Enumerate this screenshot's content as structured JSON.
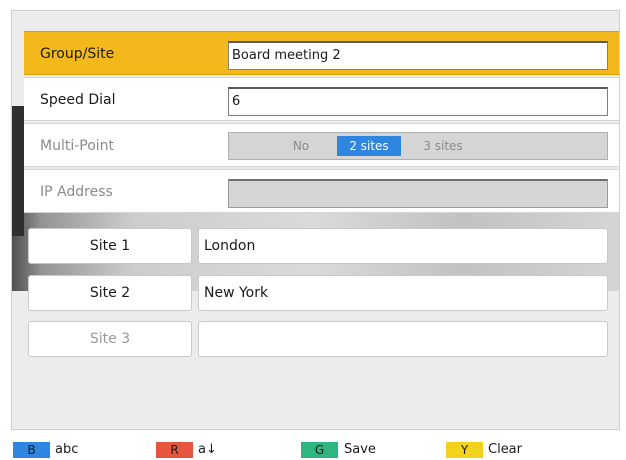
{
  "form": {
    "group_site": {
      "label": "Group/Site",
      "value": "Board meeting 2"
    },
    "speed_dial": {
      "label": "Speed Dial",
      "value": "6"
    },
    "multi_point": {
      "label": "Multi-Point",
      "options": [
        "No",
        "2 sites",
        "3 sites"
      ],
      "selected": "2 sites"
    },
    "ip_address": {
      "label": "IP Address",
      "value": ""
    }
  },
  "sites": [
    {
      "label": "Site 1",
      "value": "London"
    },
    {
      "label": "Site 2",
      "value": "New York"
    },
    {
      "label": "Site 3",
      "value": ""
    }
  ],
  "footer": {
    "keys": [
      {
        "key": "B",
        "label": "abc",
        "color": "#2e86e0"
      },
      {
        "key": "R",
        "label": "a↓",
        "color": "#e8553e"
      },
      {
        "key": "G",
        "label": "Save",
        "color": "#2fb57e"
      },
      {
        "key": "Y",
        "label": "Clear",
        "color": "#f2d21c"
      }
    ]
  },
  "colors": {
    "selected_row": "#f2b81c",
    "selected_option": "#2e86e0"
  }
}
